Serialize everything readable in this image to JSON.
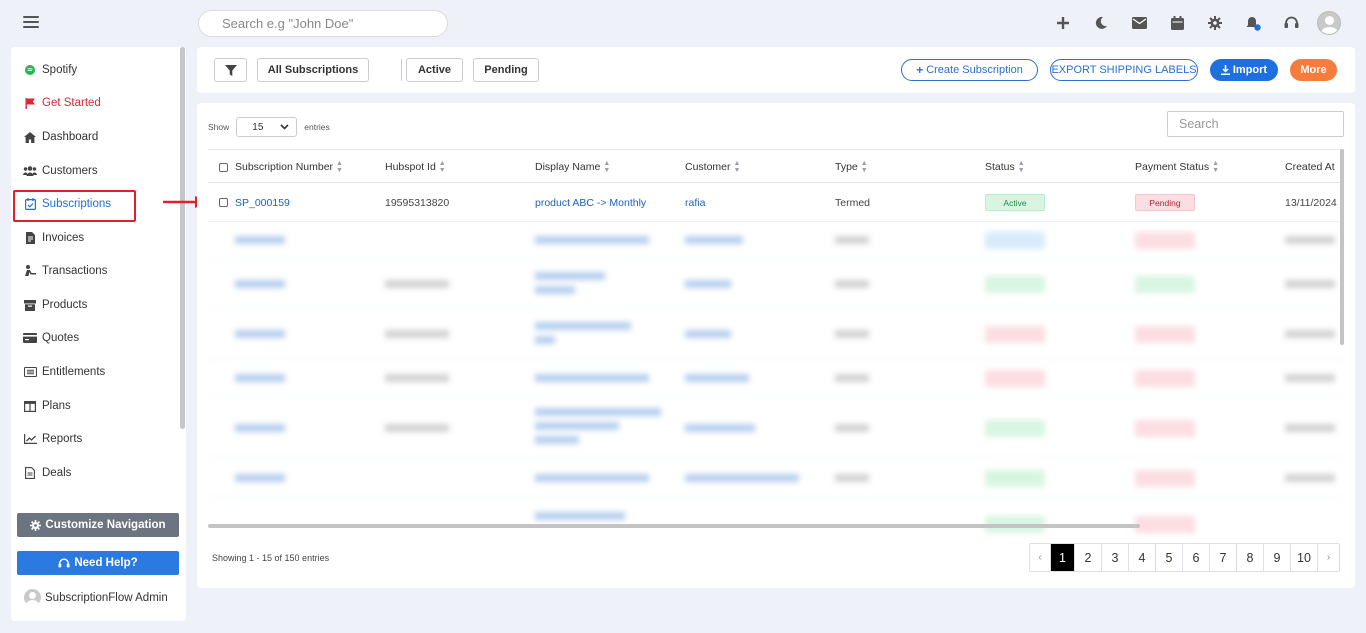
{
  "topbar": {
    "search_placeholder": "Search e.g \"John Doe\"",
    "icons": [
      "plus-icon",
      "moon-icon",
      "mail-icon",
      "calendar-icon",
      "gear-icon",
      "bell-icon",
      "headset-icon",
      "user-avatar"
    ]
  },
  "sidebar": {
    "items": [
      {
        "label": "Spotify",
        "icon": "spotify-icon"
      },
      {
        "label": "Get Started",
        "icon": "flag-icon"
      },
      {
        "label": "Dashboard",
        "icon": "home-icon"
      },
      {
        "label": "Customers",
        "icon": "users-icon"
      },
      {
        "label": "Subscriptions",
        "icon": "calendar-check-icon"
      },
      {
        "label": "Invoices",
        "icon": "file-invoice-icon"
      },
      {
        "label": "Transactions",
        "icon": "transfer-icon"
      },
      {
        "label": "Products",
        "icon": "box-icon"
      },
      {
        "label": "Quotes",
        "icon": "card-icon"
      },
      {
        "label": "Entitlements",
        "icon": "list-icon"
      },
      {
        "label": "Plans",
        "icon": "columns-icon"
      },
      {
        "label": "Reports",
        "icon": "chart-icon"
      },
      {
        "label": "Deals",
        "icon": "document-icon"
      }
    ],
    "customize_label": "Customize Navigation",
    "help_label": "Need Help?",
    "admin_name": "SubscriptionFlow Admin"
  },
  "toolbar": {
    "filter_icon": "filter-icon",
    "all_label": "All Subscriptions",
    "active_label": "Active",
    "pending_label": "Pending",
    "create_label": "Create Subscription",
    "export_label": "EXPORT SHIPPING LABELS",
    "import_label": "Import",
    "more_label": "More",
    "import_color": "#1e6fe0",
    "more_color": "#f57c3a"
  },
  "table": {
    "show_label": "Show",
    "entries_value": "15",
    "entries_label": "entries",
    "search_placeholder": "Search",
    "columns": [
      "Subscription Number",
      "Hubspot Id",
      "Display Name",
      "Customer",
      "Type",
      "Status",
      "Payment Status",
      "Created At"
    ],
    "first_row": {
      "number": "SP_000159",
      "hubspot_id": "19595313820",
      "display_name": "product ABC -> Monthly",
      "customer": "rafia",
      "type": "Termed",
      "status": "Active",
      "payment_status": "Pending",
      "created_at": "13/11/2024"
    },
    "info": "Showing 1 - 15 of 150 entries",
    "pages": [
      "1",
      "2",
      "3",
      "4",
      "5",
      "6",
      "7",
      "8",
      "9",
      "10"
    ],
    "prev_label": "‹",
    "next_label": "›"
  }
}
